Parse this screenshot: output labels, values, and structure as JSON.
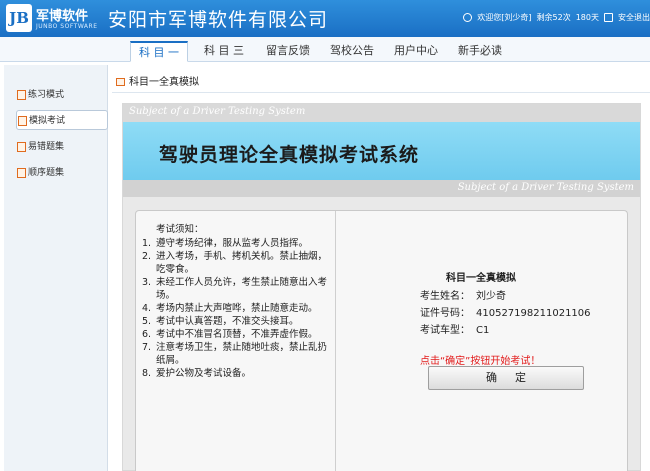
{
  "header": {
    "logo_mark": "JB",
    "logo_name": "军博软件",
    "logo_sub": "JUNBO SOFTWARE",
    "company": "安阳市军博软件有限公司",
    "welcome": "欢迎您[刘少奇]",
    "remaining": "剩余52次",
    "days": "180天",
    "logout": "安全退出"
  },
  "nav": {
    "tabs": [
      {
        "label": "科 目 一"
      },
      {
        "label": "科 目 三"
      },
      {
        "label": "留言反馈"
      },
      {
        "label": "驾校公告"
      },
      {
        "label": "用户中心"
      },
      {
        "label": "新手必读"
      }
    ]
  },
  "sidebar": {
    "items": [
      {
        "label": "练习模式"
      },
      {
        "label": "模拟考试"
      },
      {
        "label": "易错题集"
      },
      {
        "label": "顺序题集"
      }
    ]
  },
  "breadcrumb": "科目一全真模拟",
  "system": {
    "subtitle_top": "Subject of a Driver Testing System",
    "title": "驾驶员理论全真模拟考试系统",
    "subtitle_bottom": "Subject of a Driver Testing System"
  },
  "notice": {
    "title": "考试须知：",
    "items": [
      {
        "num": "1.",
        "text": "遵守考场纪律，服从监考人员指挥。"
      },
      {
        "num": "2.",
        "text": "进入考场，手机、拷机关机。禁止抽烟，吃零食。"
      },
      {
        "num": "3.",
        "text": "未经工作人员允许，考生禁止随意出入考场。"
      },
      {
        "num": "4.",
        "text": "考场内禁止大声喧哗，禁止随意走动。"
      },
      {
        "num": "5.",
        "text": "考试中认真答题，不准交头接耳。"
      },
      {
        "num": "6.",
        "text": "考试中不准冒名顶替，不准弄虚作假。"
      },
      {
        "num": "7.",
        "text": "注意考场卫生，禁止随地吐痰，禁止乱扔纸屑。"
      },
      {
        "num": "8.",
        "text": "爱护公物及考试设备。"
      }
    ]
  },
  "info": {
    "title": "科目一全真模拟",
    "name_label": "考生姓名：",
    "name": "刘少奇",
    "id_label": "证件号码：",
    "id": "410527198211021106",
    "car_label": "考试车型：",
    "car": "C1",
    "tip": "点击“确定”按钮开始考试！",
    "confirm": "确定"
  }
}
